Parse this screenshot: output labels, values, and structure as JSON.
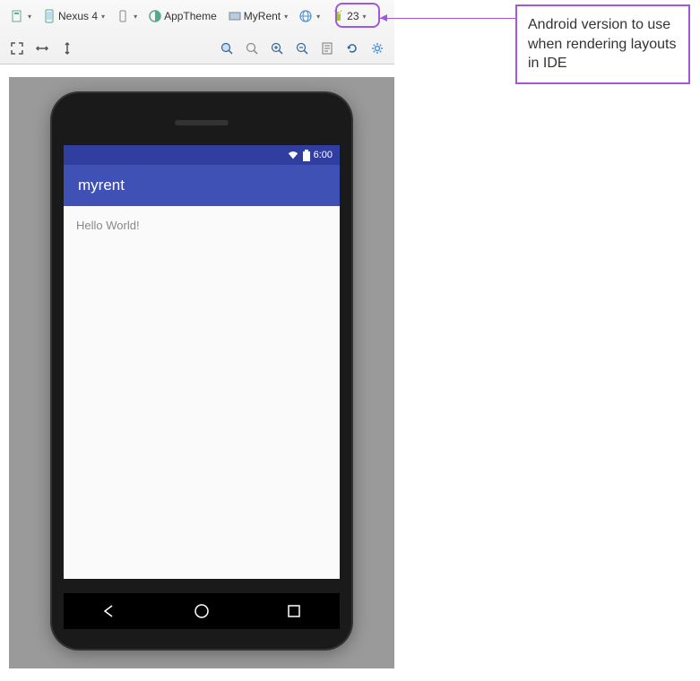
{
  "toolbar": {
    "device_label": "Nexus 4",
    "theme_label": "AppTheme",
    "activity_label": "MyRent",
    "api_label": "23"
  },
  "callout": {
    "text": "Android version to use when rendering layouts in IDE"
  },
  "phone": {
    "status_time": "6:00",
    "app_title": "myrent",
    "content_text": "Hello World!"
  }
}
